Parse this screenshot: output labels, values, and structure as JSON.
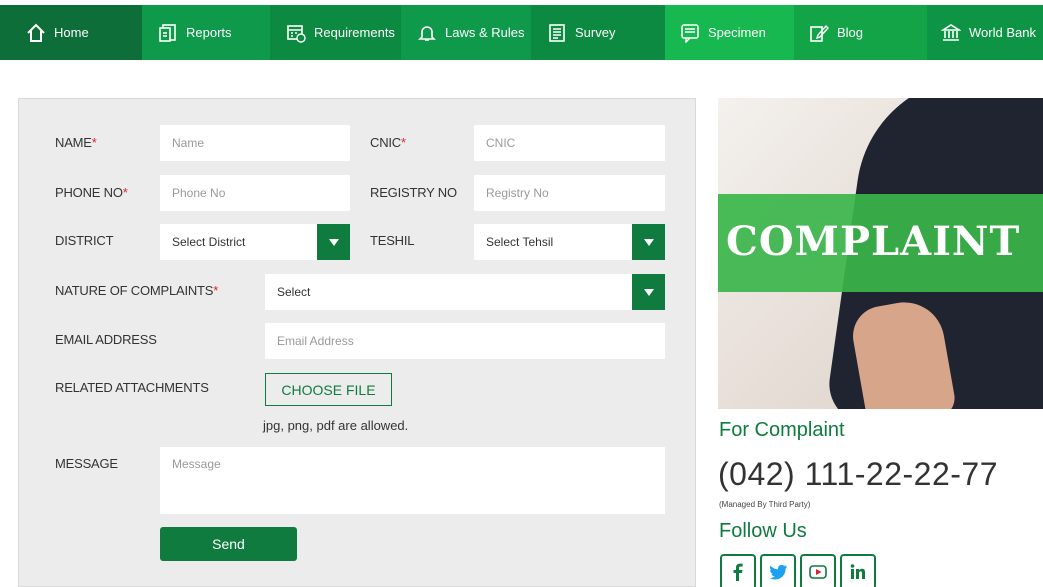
{
  "nav": {
    "items": [
      {
        "label": "Home",
        "icon": "home-icon"
      },
      {
        "label": "Reports",
        "icon": "reports-icon"
      },
      {
        "label": "Requirements",
        "icon": "requirements-icon"
      },
      {
        "label": "Laws & Rules",
        "icon": "bell-icon"
      },
      {
        "label": "Survey",
        "icon": "survey-icon"
      },
      {
        "label": "Specimen",
        "icon": "specimen-icon"
      },
      {
        "label": "Blog",
        "icon": "blog-icon"
      },
      {
        "label": "World Bank",
        "icon": "bank-icon"
      }
    ]
  },
  "form": {
    "name": {
      "label": "NAME",
      "required": "*",
      "placeholder": "Name"
    },
    "cnic": {
      "label": "CNIC",
      "required": "*",
      "placeholder": "CNIC"
    },
    "phone": {
      "label": "PHONE NO",
      "required": "*",
      "placeholder": "Phone No"
    },
    "registry": {
      "label": "REGISTRY NO",
      "placeholder": "Registry No"
    },
    "district": {
      "label": "DISTRICT",
      "value": "Select District"
    },
    "tehsil": {
      "label": "TESHIL",
      "value": "Select Tehsil"
    },
    "nature": {
      "label": "NATURE OF COMPLAINTS",
      "required": "*",
      "value": "Select"
    },
    "email": {
      "label": "EMAIL ADDRESS",
      "placeholder": "Email Address"
    },
    "attachments": {
      "label": "RELATED ATTACHMENTS",
      "button": "CHOOSE FILE",
      "hint": "jpg, png, pdf are allowed."
    },
    "message": {
      "label": "MESSAGE",
      "placeholder": "Message"
    },
    "send": "Send"
  },
  "sidebar": {
    "banner_word": "COMPLAINT",
    "for_complaint": "For Complaint",
    "phone": "(042) 111-22-22-77",
    "managed": "(Managed By Third Party)",
    "follow": "Follow Us",
    "socials": [
      "facebook-icon",
      "twitter-icon",
      "youtube-icon",
      "linkedin-icon"
    ]
  },
  "colors": {
    "brand_dark": "#0f7b3e",
    "brand_light": "#17b84f",
    "required": "#d9252c",
    "panel_bg": "#ececec"
  }
}
